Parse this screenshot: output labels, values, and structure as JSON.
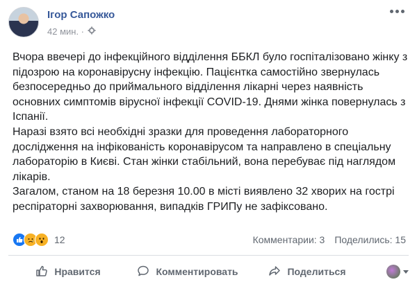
{
  "author": {
    "name": "Ігор Сапожко",
    "time": "42 мин. ·",
    "privacy_icon": "gear-icon"
  },
  "post": {
    "paragraphs": [
      "Вчора ввечері до інфекційного відділення ББКЛ було госпіталізовано жінку з підозрою на коронавірусну інфекцію. Пацієнтка самостійно звернулась безпосередньо до приймального відділення лікарні через наявність основних симптомів вірусної інфекції COVID-19. Днями жінка повернулась з Іспанії.",
      "Наразі взято всі необхідні зразки для проведення лабораторного дослідження на інфікованість коронавірусом та направлено в спеціальну лабораторію в Києві. Стан жінки стабільний, вона перебуває під наглядом лікарів.",
      "Загалом, станом на 18 березня 10.00 в місті виявлено 32 хворих на гострі респіраторні захворювання, випадків ГРИПу не зафіксовано."
    ]
  },
  "reactions": {
    "icons": [
      "like-icon",
      "sad-icon",
      "wow-icon"
    ],
    "count": "12"
  },
  "stats": {
    "comments": "Комментарии: 3",
    "shares": "Поделились: 15"
  },
  "actions": {
    "like": "Нравится",
    "comment": "Комментировать",
    "share": "Поделиться"
  },
  "colors": {
    "name": "#365899",
    "like": "#1877f2",
    "reaction_yellow": "#f7b125",
    "muted": "#606770"
  }
}
